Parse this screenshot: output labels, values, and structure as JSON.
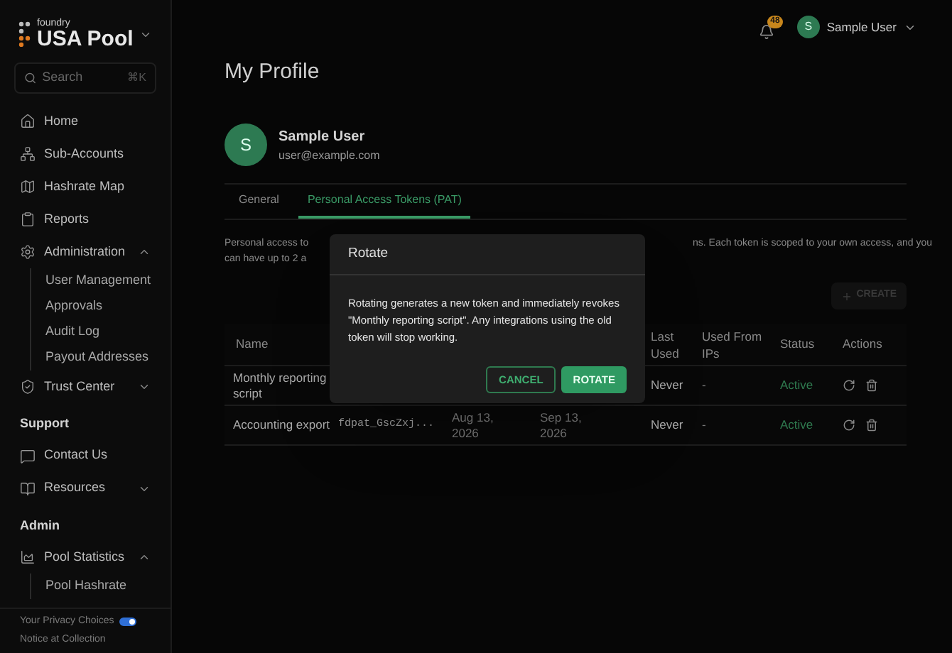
{
  "sidebar": {
    "brand_small": "foundry",
    "brand": "USA Pool",
    "search": {
      "placeholder": "Search",
      "shortcut": "⌘K"
    },
    "items": [
      {
        "label": "Home"
      },
      {
        "label": "Sub-Accounts"
      },
      {
        "label": "Hashrate Map"
      },
      {
        "label": "Reports"
      },
      {
        "label": "Administration",
        "expanded": true,
        "children": [
          {
            "label": "User Management"
          },
          {
            "label": "Approvals"
          },
          {
            "label": "Audit Log"
          },
          {
            "label": "Payout Addresses"
          }
        ]
      },
      {
        "label": "Trust Center",
        "expanded": false
      },
      {
        "kind": "section",
        "label": "Support"
      },
      {
        "label": "Contact Us"
      },
      {
        "label": "Resources",
        "expanded": false
      },
      {
        "kind": "section",
        "label": "Admin"
      },
      {
        "label": "Pool Statistics",
        "expanded": true,
        "children": [
          {
            "label": "Pool Hashrate"
          }
        ]
      }
    ],
    "footer": [
      "Your Privacy Choices",
      "Notice at Collection"
    ]
  },
  "header": {
    "notifications": "48",
    "user": "Sample User",
    "avatar": "S"
  },
  "page": {
    "title": "My Profile",
    "profile": {
      "avatar": "S",
      "name": "Sample User",
      "email": "user@example.com"
    },
    "tabs": [
      {
        "label": "General",
        "selected": false
      },
      {
        "label": "Personal Access Tokens (PAT)",
        "selected": true
      }
    ],
    "description_left": [
      "Personal access to",
      "can have up to 2 a"
    ],
    "description_right": "ns. Each token is scoped to your own access, and you",
    "create_button": "CREATE",
    "table": {
      "columns": {
        "name": "Name",
        "last_used": "Last Used",
        "used_from_ips": "Used From IPs",
        "status": "Status",
        "actions": "Actions"
      },
      "rows": [
        {
          "name": "Monthly reporting script",
          "last_used": "Never",
          "used_from_ips": "-",
          "status": "Active"
        },
        {
          "name": "Accounting export",
          "token": "fdpat_GscZxj...",
          "created": "Aug 13, 2026",
          "expires": "Sep 13, 2026",
          "last_used": "Never",
          "used_from_ips": "-",
          "status": "Active"
        }
      ]
    }
  },
  "dialog": {
    "title": "Rotate",
    "message": "Rotating generates a new token and immediately revokes \"Monthly reporting script\". Any integrations using the old token will stop working.",
    "buttons": [
      {
        "label": "CANCEL",
        "kind": "secondary"
      },
      {
        "label": "ROTATE",
        "kind": "primary"
      }
    ]
  }
}
